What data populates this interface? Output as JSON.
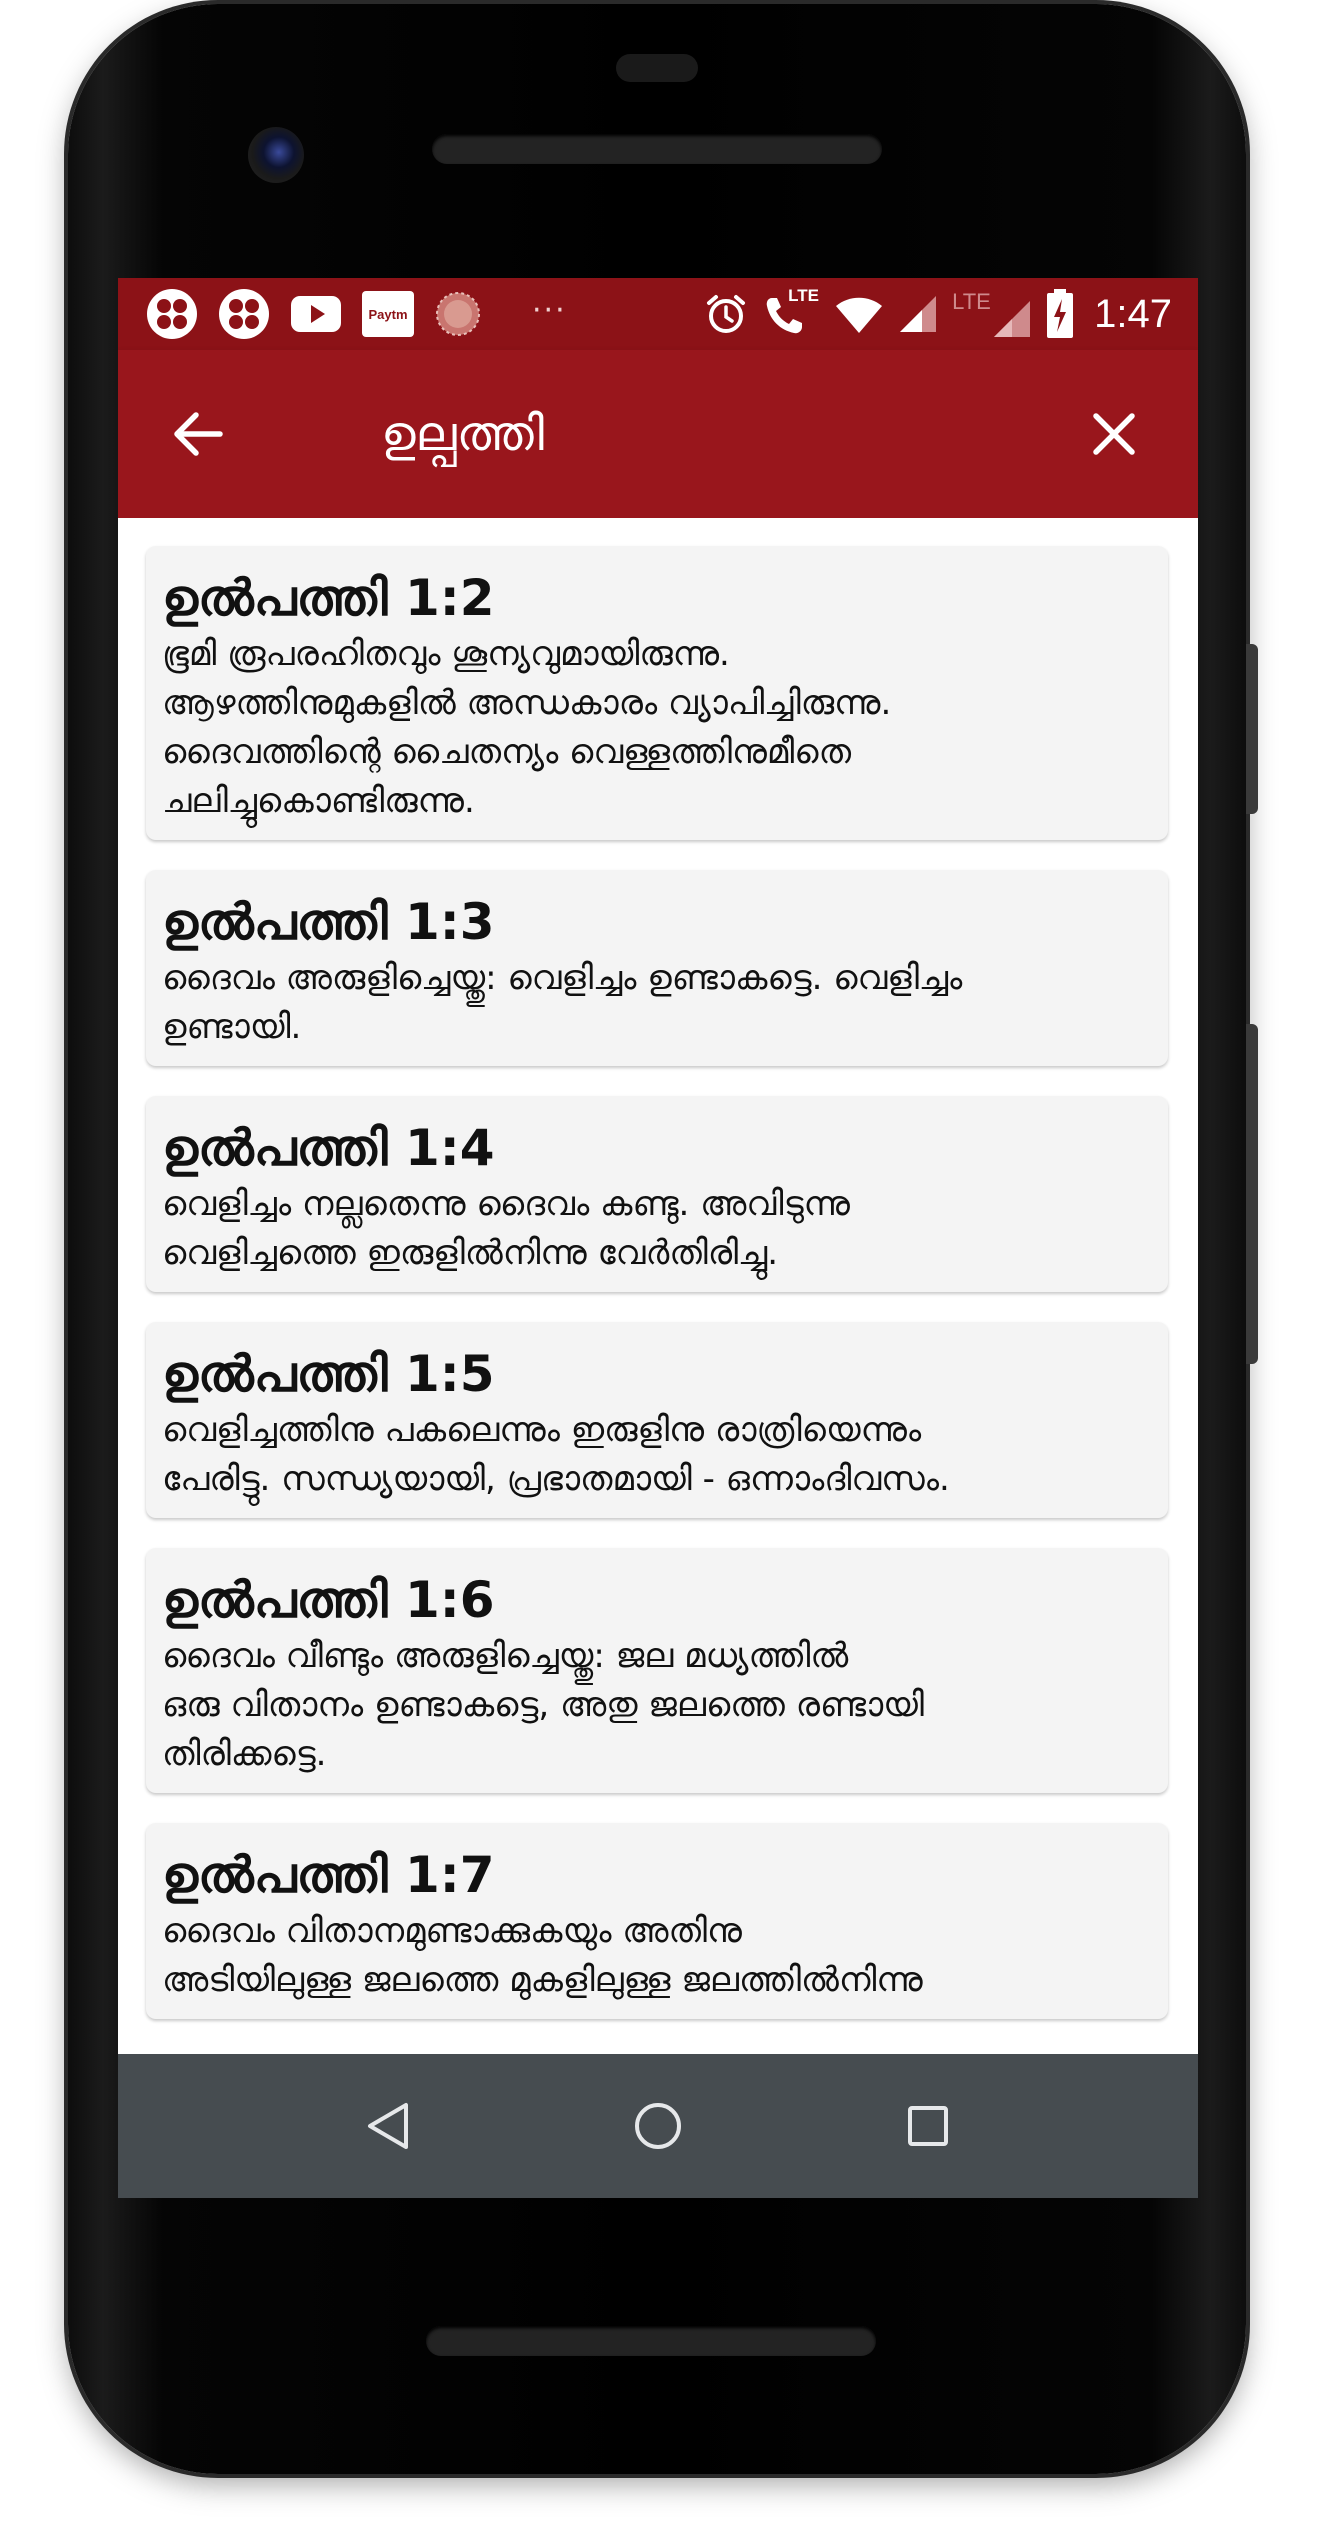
{
  "status_bar": {
    "paytm_label": "Paytm",
    "overflow_dots": "···",
    "lte_label_1": "LTE",
    "lte_label_2": "LTE",
    "time": "1:47",
    "left_icons": [
      "pinwheel-app-icon",
      "pinwheel-app-icon",
      "youtube-icon",
      "paytm-icon",
      "circular-app-icon"
    ],
    "right_icons": [
      "alarm-icon",
      "lte-call-icon",
      "wifi-icon",
      "cell-signal-icon",
      "cell-signal-icon",
      "battery-charging-icon"
    ]
  },
  "app_bar": {
    "title": "ഉല്പത്തി",
    "back_icon": "arrow-left-icon",
    "close_icon": "close-icon",
    "color": "#99161c"
  },
  "verses": [
    {
      "ref": "ഉൽപത്തി 1:2",
      "lines": [
        "ഭൂമി രൂപരഹിതവും ശൂന്യവുമായിരുന്നു.",
        "ആഴത്തിനുമുകളിൽ അന്ധകാരം വ്യാപിച്ചിരുന്നു.",
        "ദൈവത്തിന്റെ ചൈതന്യം വെള്ളത്തിനുമീതെ",
        "ചലിച്ചുകൊണ്ടിരുന്നു."
      ]
    },
    {
      "ref": "ഉൽപത്തി 1:3",
      "lines": [
        "ദൈവം അരുളിച്ചെയ്തു: വെളിച്ചം ഉണ്ടാകട്ടെ. വെളിച്ചം",
        "ഉണ്ടായി."
      ]
    },
    {
      "ref": "ഉൽപത്തി 1:4",
      "lines": [
        "വെളിച്ചം നല്ലതെന്നു ദൈവം കണ്ടു. അവിടുന്നു",
        "വെളിച്ചത്തെ ഇരുളിൽനിന്നു വേർതിരിച്ചു."
      ]
    },
    {
      "ref": "ഉൽപത്തി 1:5",
      "lines": [
        "വെളിച്ചത്തിനു പകലെന്നും ഇരുളിനു രാത്രിയെന്നും",
        "പേരിട്ടു. സന്ധ്യയായി, പ്രഭാതമായി - ഒന്നാംദിവസം."
      ]
    },
    {
      "ref": "ഉൽപത്തി 1:6",
      "lines": [
        "ദൈവം വീണ്ടും അരുളിച്ചെയ്തു: ജല മധ്യത്തിൽ",
        "ഒരു വിതാനം ഉണ്ടാകട്ടെ, അതു ജലത്തെ രണ്ടായി",
        "തിരിക്കട്ടെ."
      ]
    },
    {
      "ref": "ഉൽപത്തി 1:7",
      "lines": [
        "ദൈവം വിതാനമുണ്ടാക്കുകയും അതിനു",
        "അടിയിലുള്ള ജലത്തെ മുകളിലുള്ള ജലത്തിൽനിന്നു"
      ]
    }
  ],
  "nav_bar": {
    "back_icon": "nav-back-triangle-icon",
    "home_icon": "nav-home-circle-icon",
    "recents_icon": "nav-recents-square-icon",
    "color": "#464c50"
  }
}
